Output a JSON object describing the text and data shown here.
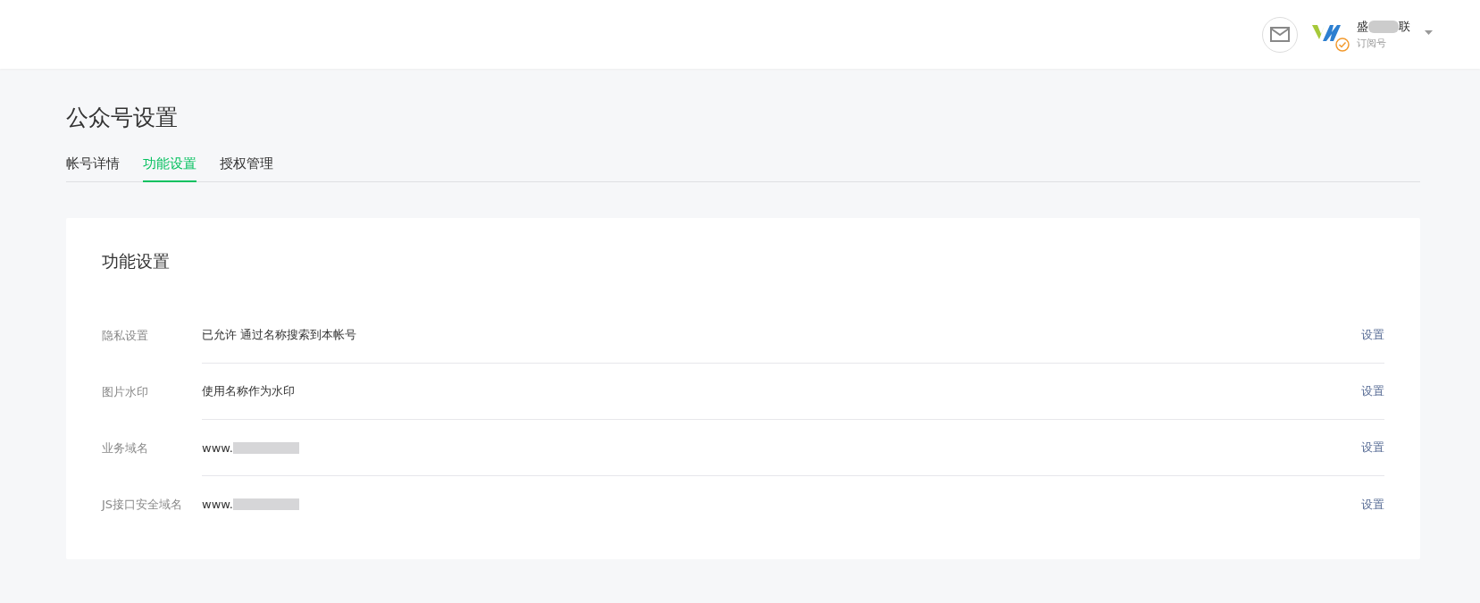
{
  "header": {
    "account": {
      "name_start": "盛",
      "name_end": "联",
      "type": "订阅号"
    }
  },
  "page": {
    "title": "公众号设置"
  },
  "tabs": [
    {
      "label": "帐号详情",
      "selected": false
    },
    {
      "label": "功能设置",
      "selected": true
    },
    {
      "label": "授权管理",
      "selected": false
    }
  ],
  "card": {
    "title": "功能设置",
    "rows": [
      {
        "label": "隐私设置",
        "value": "已允许 通过名称搜索到本帐号",
        "redacted": false,
        "action": "设置"
      },
      {
        "label": "图片水印",
        "value": "使用名称作为水印",
        "redacted": false,
        "action": "设置"
      },
      {
        "label": "业务域名",
        "value": "www.",
        "redacted": true,
        "action": "设置"
      },
      {
        "label": "JS接口安全域名",
        "value": "www.",
        "redacted": true,
        "action": "设置"
      }
    ]
  }
}
